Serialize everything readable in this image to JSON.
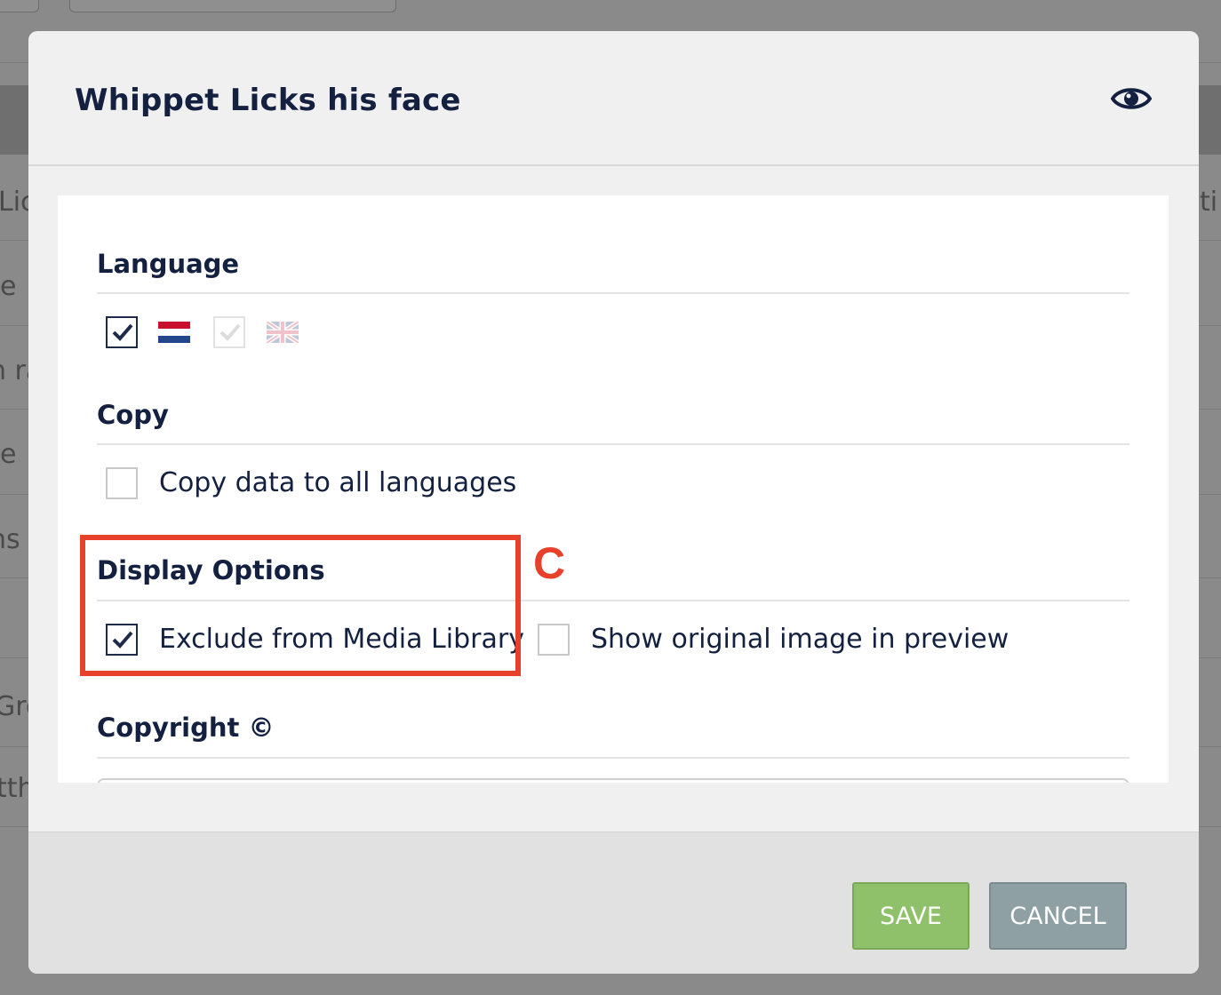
{
  "background": {
    "fragments": [
      "Lic",
      "e",
      "n ra",
      "e",
      "ns",
      "Gre",
      "tth",
      "ti"
    ]
  },
  "modal": {
    "title": "Whippet Licks his face",
    "preview_icon": "eye-icon",
    "sections": {
      "language": {
        "title": "Language",
        "items": [
          {
            "flag": "netherlands-flag",
            "checked": true,
            "enabled": true
          },
          {
            "flag": "uk-flag",
            "checked": true,
            "enabled": false
          }
        ]
      },
      "copy": {
        "title": "Copy",
        "option_label": "Copy data to all languages",
        "checked": false
      },
      "display_options": {
        "title": "Display Options",
        "options": [
          {
            "label": "Exclude from Media Library",
            "checked": true
          },
          {
            "label": "Show original image in preview",
            "checked": false
          }
        ]
      },
      "copyright": {
        "title": "Copyright ©"
      }
    },
    "footer": {
      "save_label": "SAVE",
      "cancel_label": "CANCEL"
    }
  },
  "annotation": {
    "label": "C",
    "color": "#e8412b"
  },
  "colors": {
    "save": "#8fc16a",
    "cancel": "#8fa0a4",
    "title": "#142040"
  }
}
